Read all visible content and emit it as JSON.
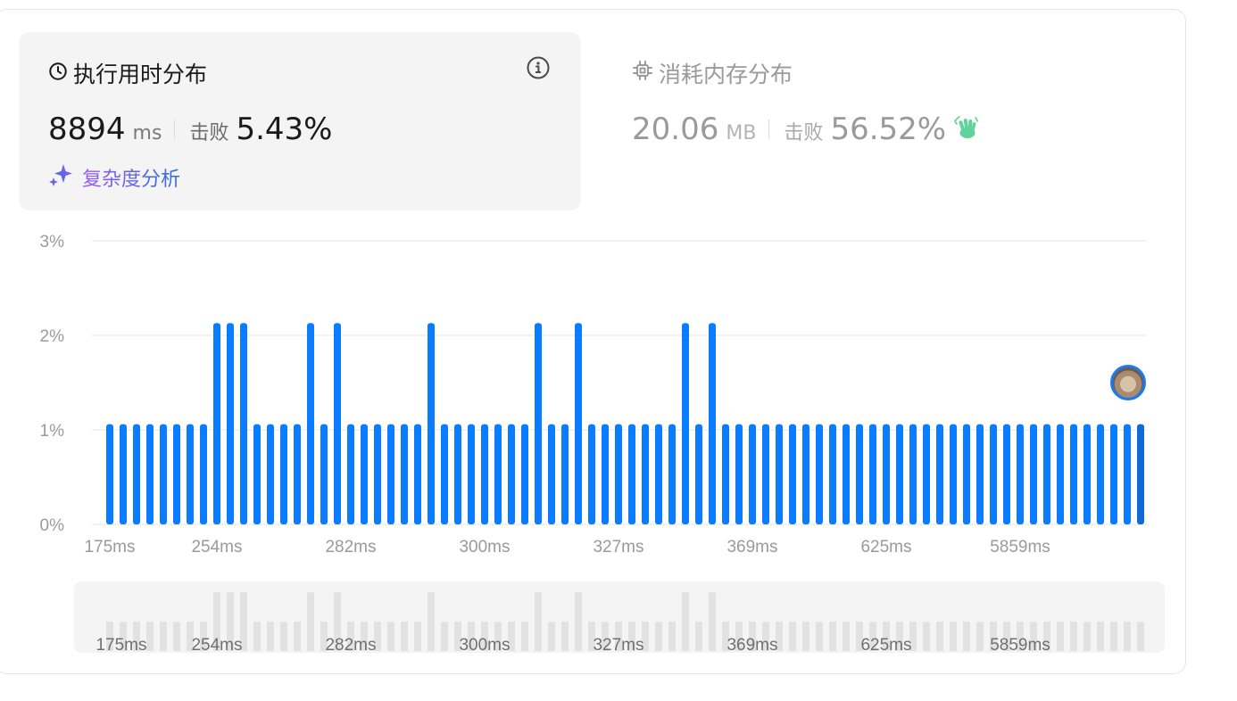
{
  "runtime_panel": {
    "title": "执行用时分布",
    "value": "8894",
    "unit": "ms",
    "beat_label": "击败",
    "beat_pct": "5.43%",
    "complexity_label": "复杂度分析"
  },
  "memory_panel": {
    "title": "消耗内存分布",
    "value": "20.06",
    "unit": "MB",
    "beat_label": "击败",
    "beat_pct": "56.52%"
  },
  "icons": {
    "clock": "clock-icon",
    "info": "info-icon",
    "chip": "chip-icon",
    "sparkle": "sparkle-icon",
    "wave": "waving-hand-icon"
  },
  "colors": {
    "bar": "#0a7cff",
    "bar_user": "#0d6ad6",
    "brush_bar": "#e2e2e2",
    "wave": "#5fd39a"
  },
  "chart_data": {
    "type": "bar",
    "ylabel_ticks": [
      "0%",
      "1%",
      "2%",
      "3%"
    ],
    "ylim": [
      0,
      3
    ],
    "x_tick_labels": [
      "175ms",
      "254ms",
      "282ms",
      "300ms",
      "327ms",
      "369ms",
      "625ms",
      "5859ms"
    ],
    "x_tick_bar_index": [
      0,
      8,
      18,
      28,
      38,
      48,
      58,
      68
    ],
    "values": [
      1.06,
      1.06,
      1.06,
      1.06,
      1.06,
      1.06,
      1.06,
      1.06,
      2.13,
      2.13,
      2.13,
      1.06,
      1.06,
      1.06,
      1.06,
      2.13,
      1.06,
      2.13,
      1.06,
      1.06,
      1.06,
      1.06,
      1.06,
      1.06,
      2.13,
      1.06,
      1.06,
      1.06,
      1.06,
      1.06,
      1.06,
      1.06,
      2.13,
      1.06,
      1.06,
      2.13,
      1.06,
      1.06,
      1.06,
      1.06,
      1.06,
      1.06,
      1.06,
      2.13,
      1.06,
      2.13,
      1.06,
      1.06,
      1.06,
      1.06,
      1.06,
      1.06,
      1.06,
      1.06,
      1.06,
      1.06,
      1.06,
      1.06,
      1.06,
      1.06,
      1.06,
      1.06,
      1.06,
      1.06,
      1.06,
      1.06,
      1.06,
      1.06,
      1.06,
      1.06,
      1.06,
      1.06,
      1.06,
      1.06,
      1.06,
      1.06,
      1.06,
      1.06
    ],
    "user_bar_index": 77,
    "grid": true
  }
}
